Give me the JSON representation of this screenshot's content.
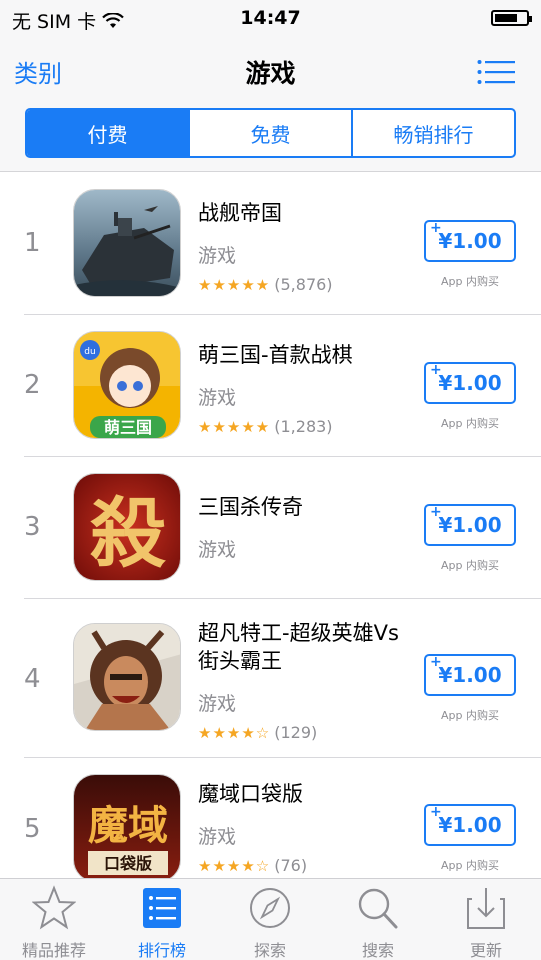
{
  "status_bar": {
    "carrier": "无 SIM 卡",
    "time": "14:47"
  },
  "nav": {
    "back_label": "类别",
    "title": "游戏",
    "list_icon": "list-icon"
  },
  "segments": [
    {
      "label": "付费",
      "active": true
    },
    {
      "label": "免费",
      "active": false
    },
    {
      "label": "畅销排行",
      "active": false
    }
  ],
  "apps": [
    {
      "rank": "1",
      "name": "战舰帝国",
      "category": "游戏",
      "stars": "★★★★★",
      "rating_count": "(5,876)",
      "price": "¥1.00",
      "iap": "App 内购买"
    },
    {
      "rank": "2",
      "name": "萌三国-首款战棋",
      "category": "游戏",
      "stars": "★★★★★",
      "rating_count": "(1,283)",
      "price": "¥1.00",
      "iap": "App 内购买"
    },
    {
      "rank": "3",
      "name": "三国杀传奇",
      "category": "游戏",
      "stars": "",
      "rating_count": "",
      "price": "¥1.00",
      "iap": "App 内购买"
    },
    {
      "rank": "4",
      "name": "超凡特工-超级英雄Vs街头霸王",
      "category": "游戏",
      "stars": "★★★★☆",
      "rating_count": "(129)",
      "price": "¥1.00",
      "iap": "App 内购买"
    },
    {
      "rank": "5",
      "name": "魔域口袋版",
      "category": "游戏",
      "stars": "★★★★☆",
      "rating_count": "(76)",
      "price": "¥1.00",
      "iap": "App 内购买"
    }
  ],
  "app_icon_text": {
    "app2": "萌三国",
    "app3": "殺",
    "app5_main": "魔域",
    "app5_sub": "口袋版"
  },
  "tabs": [
    {
      "label": "精品推荐",
      "icon": "star-icon"
    },
    {
      "label": "排行榜",
      "icon": "ranking-list-icon"
    },
    {
      "label": "探索",
      "icon": "compass-icon"
    },
    {
      "label": "搜索",
      "icon": "search-icon"
    },
    {
      "label": "更新",
      "icon": "update-icon"
    }
  ],
  "colors": {
    "accent": "#1a7cf5",
    "star": "#f5a623",
    "secondary_text": "#8e8e93"
  }
}
